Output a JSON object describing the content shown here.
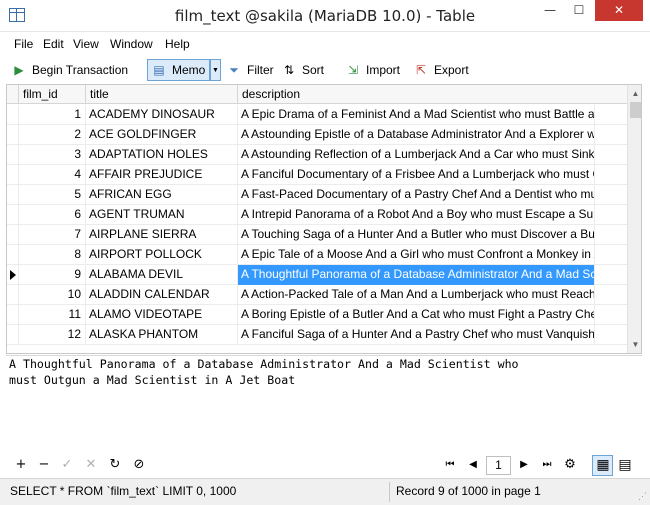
{
  "window": {
    "title": "film_text @sakila (MariaDB 10.0) - Table",
    "min_glyph": "—",
    "max_glyph": "☐",
    "close_glyph": "✕"
  },
  "menu": [
    "File",
    "Edit",
    "View",
    "Window",
    "Help"
  ],
  "toolbar": {
    "begin_transaction": "Begin Transaction",
    "memo": "Memo",
    "filter": "Filter",
    "sort": "Sort",
    "import": "Import",
    "export": "Export"
  },
  "grid": {
    "columns": [
      "film_id",
      "title",
      "description"
    ],
    "rows": [
      {
        "id": "1",
        "title": "ACADEMY DINOSAUR",
        "description": "A Epic Drama of a Feminist And a Mad Scientist who must Battle a Teacher"
      },
      {
        "id": "2",
        "title": "ACE GOLDFINGER",
        "description": "A Astounding Epistle of a Database Administrator And a Explorer who must Find a Car"
      },
      {
        "id": "3",
        "title": "ADAPTATION HOLES",
        "description": "A Astounding Reflection of a Lumberjack And a Car who must Sink a Lumberjack"
      },
      {
        "id": "4",
        "title": "AFFAIR PREJUDICE",
        "description": "A Fanciful Documentary of a Frisbee And a Lumberjack who must Chase a Monkey"
      },
      {
        "id": "5",
        "title": "AFRICAN EGG",
        "description": "A Fast-Paced Documentary of a Pastry Chef And a Dentist who must Pursue a Forensic Psychologist"
      },
      {
        "id": "6",
        "title": "AGENT TRUMAN",
        "description": "A Intrepid Panorama of a Robot And a Boy who must Escape a Sumo Wrestler"
      },
      {
        "id": "7",
        "title": "AIRPLANE SIERRA",
        "description": "A Touching Saga of a Hunter And a Butler who must Discover a Butler"
      },
      {
        "id": "8",
        "title": "AIRPORT POLLOCK",
        "description": "A Epic Tale of a Moose And a Girl who must Confront a Monkey in Ancient India"
      },
      {
        "id": "9",
        "title": "ALABAMA DEVIL",
        "description": "A Thoughtful Panorama of a Database Administrator And a Mad Scientist who must Outgun a Mad Scientist in A Jet Boat"
      },
      {
        "id": "10",
        "title": "ALADDIN CALENDAR",
        "description": "A Action-Packed Tale of a Man And a Lumberjack who must Reach a Feminist"
      },
      {
        "id": "11",
        "title": "ALAMO VIDEOTAPE",
        "description": "A Boring Epistle of a Butler And a Cat who must Fight a Pastry Chef"
      },
      {
        "id": "12",
        "title": "ALASKA PHANTOM",
        "description": "A Fanciful Saga of a Hunter And a Pastry Chef who must Vanquish a Boy"
      }
    ],
    "selected_row_index": 8
  },
  "memo": {
    "text": "A Thoughtful Panorama of a Database Administrator And a Mad Scientist who\nmust Outgun a Mad Scientist in A Jet Boat"
  },
  "navigation": {
    "page": "1"
  },
  "status": {
    "query": "SELECT * FROM `film_text` LIMIT 0, 1000",
    "record": "Record 9 of 1000 in page 1"
  },
  "colors": {
    "selection": "#3399ff",
    "close_button": "#c7372f",
    "toggle_bg": "#dcebfa"
  }
}
